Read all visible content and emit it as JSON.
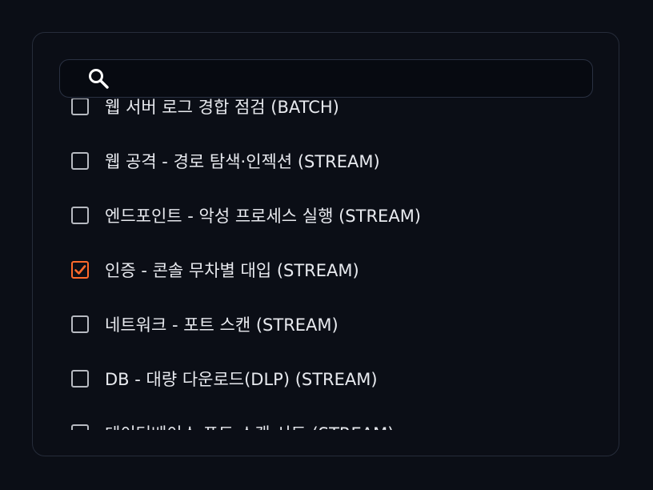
{
  "search": {
    "placeholder": "",
    "value": ""
  },
  "accent": "#ff6a2b",
  "items": [
    {
      "label": "웹 서버 로그 경합 점검 (BATCH)",
      "checked": false
    },
    {
      "label": "웹 공격 - 경로 탐색·인젝션 (STREAM)",
      "checked": false
    },
    {
      "label": "엔드포인트 - 악성 프로세스 실행 (STREAM)",
      "checked": false
    },
    {
      "label": "인증 - 콘솔 무차별 대입 (STREAM)",
      "checked": true
    },
    {
      "label": "네트워크 - 포트 스캔 (STREAM)",
      "checked": false
    },
    {
      "label": "DB - 대량 다운로드(DLP) (STREAM)",
      "checked": false
    },
    {
      "label": "데이터베이스 포트 스캔 시도 (STREAM)",
      "checked": false
    }
  ]
}
